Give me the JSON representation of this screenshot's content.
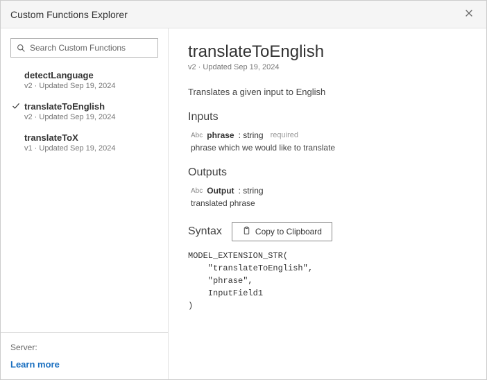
{
  "header": {
    "title": "Custom Functions Explorer"
  },
  "search": {
    "placeholder": "Search Custom Functions"
  },
  "functions": [
    {
      "name": "detectLanguage",
      "meta": "v2 · Updated Sep 19, 2024",
      "selected": false
    },
    {
      "name": "translateToEnglish",
      "meta": "v2 · Updated Sep 19, 2024",
      "selected": true
    },
    {
      "name": "translateToX",
      "meta": "v1 · Updated Sep 19, 2024",
      "selected": false
    }
  ],
  "footer": {
    "server_label": "Server:",
    "learn_more": "Learn more"
  },
  "detail": {
    "title": "translateToEnglish",
    "meta": "v2 · Updated Sep 19, 2024",
    "description": "Translates a given input to English",
    "inputs_h": "Inputs",
    "input": {
      "type_icon": "Abc",
      "name": "phrase",
      "type": ": string",
      "required": "required",
      "desc": "phrase which we would like to translate"
    },
    "outputs_h": "Outputs",
    "output": {
      "type_icon": "Abc",
      "name": "Output",
      "type": ": string",
      "desc": "translated phrase"
    },
    "syntax_h": "Syntax",
    "copy_label": "Copy to Clipboard",
    "code": "MODEL_EXTENSION_STR(\n    \"translateToEnglish\",\n    \"phrase\",\n    InputField1\n)"
  }
}
